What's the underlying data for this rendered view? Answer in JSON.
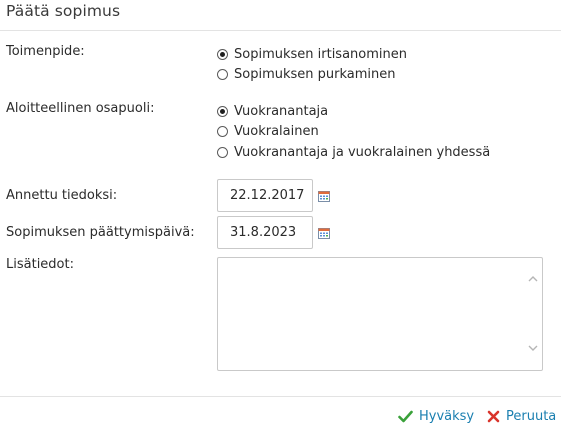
{
  "dialog": {
    "title": "Päätä sopimus"
  },
  "form": {
    "action_label": "Toimenpide:",
    "action_options": [
      {
        "label": "Sopimuksen irtisanominen",
        "checked": true
      },
      {
        "label": "Sopimuksen purkaminen",
        "checked": false
      }
    ],
    "initiator_label": "Aloitteellinen osapuoli:",
    "initiator_options": [
      {
        "label": "Vuokranantaja",
        "checked": true
      },
      {
        "label": "Vuokralainen",
        "checked": false
      },
      {
        "label": "Vuokranantaja ja vuokralainen yhdessä",
        "checked": false
      }
    ],
    "notified_label": "Annettu tiedoksi:",
    "notified_value": "22.12.2017",
    "end_date_label": "Sopimuksen päättymispäivä:",
    "end_date_value": "31.8.2023",
    "notes_label": "Lisätiedot:",
    "notes_value": ""
  },
  "footer": {
    "ok_label": "Hyväksy",
    "cancel_label": "Peruuta"
  },
  "icons": {
    "ok": "check-icon",
    "cancel": "close-icon",
    "calendar": "calendar-icon"
  },
  "colors": {
    "link": "#1a7fb0",
    "check": "#3aa13a",
    "cancel": "#d9342b"
  }
}
